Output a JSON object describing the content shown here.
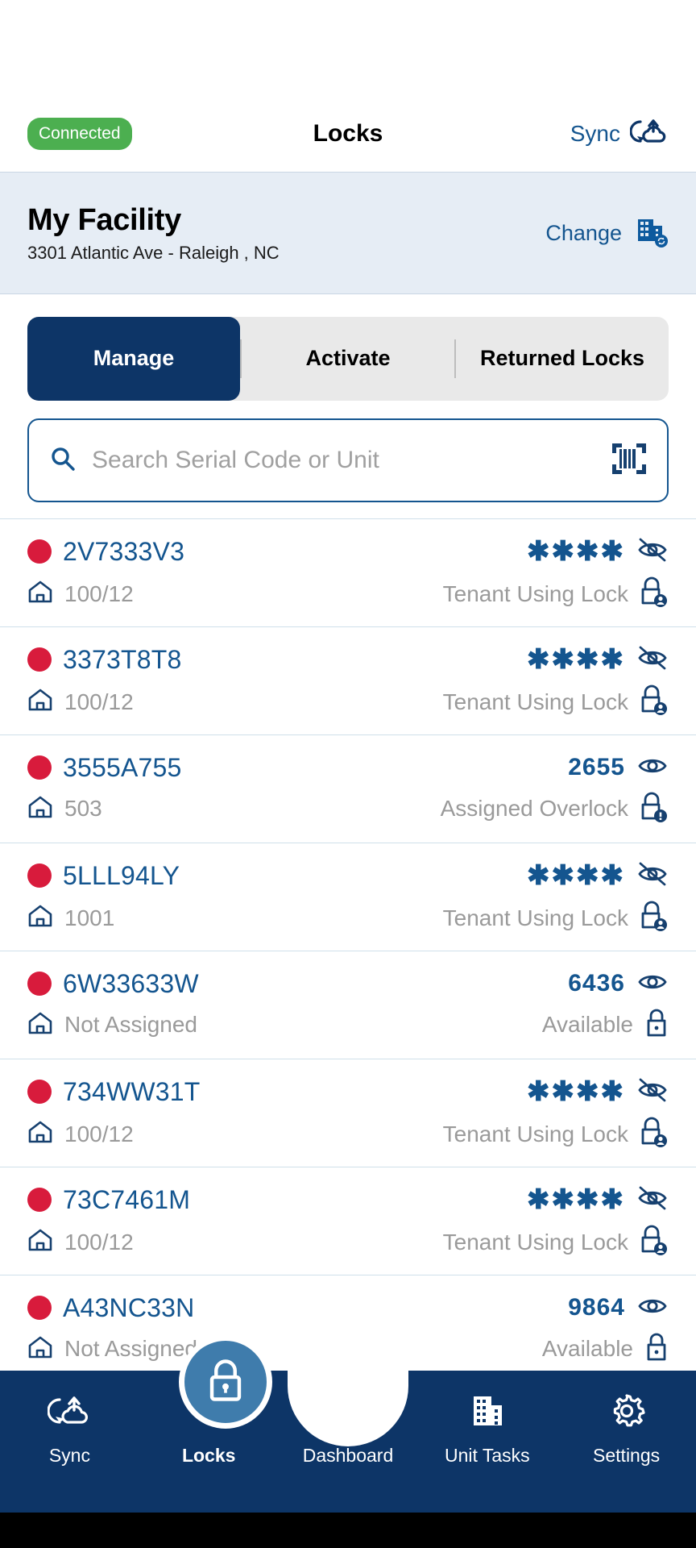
{
  "status_bar": {
    "connection_badge": "Connected"
  },
  "topbar": {
    "title": "Locks",
    "sync_label": "Sync",
    "sync_icon": "cloud-sync-icon"
  },
  "facility": {
    "name": "My Facility",
    "address": "3301 Atlantic Ave - Raleigh , NC",
    "change_label": "Change",
    "change_icon": "building-swap-icon"
  },
  "tabs": [
    {
      "label": "Manage",
      "active": true
    },
    {
      "label": "Activate",
      "active": false
    },
    {
      "label": "Returned Locks",
      "active": false
    }
  ],
  "tab_labels": {
    "manage": "Manage",
    "activate": "Activate",
    "returned_locks": "Returned Locks"
  },
  "search": {
    "placeholder": "Search Serial Code or Unit",
    "value": "",
    "search_icon": "search-icon",
    "scan_icon": "barcode-scan-icon"
  },
  "locks": [
    {
      "serial": "2V7333V3",
      "unit": "100/12",
      "code": "✱✱✱✱",
      "code_masked": true,
      "status": "Tenant Using Lock",
      "eye_icon": "eye-off-icon",
      "lock_icon": "lock-tenant-icon",
      "dot_color": "#d81b3c"
    },
    {
      "serial": "3373T8T8",
      "unit": "100/12",
      "code": "✱✱✱✱",
      "code_masked": true,
      "status": "Tenant Using Lock",
      "eye_icon": "eye-off-icon",
      "lock_icon": "lock-tenant-icon",
      "dot_color": "#d81b3c"
    },
    {
      "serial": "3555A755",
      "unit": "503",
      "code": "2655",
      "code_masked": false,
      "status": "Assigned Overlock",
      "eye_icon": "eye-icon",
      "lock_icon": "lock-alert-icon",
      "dot_color": "#d81b3c"
    },
    {
      "serial": "5LLL94LY",
      "unit": "1001",
      "code": "✱✱✱✱",
      "code_masked": true,
      "status": "Tenant Using Lock",
      "eye_icon": "eye-off-icon",
      "lock_icon": "lock-tenant-icon",
      "dot_color": "#d81b3c"
    },
    {
      "serial": "6W33633W",
      "unit": "Not Assigned",
      "code": "6436",
      "code_masked": false,
      "status": "Available",
      "eye_icon": "eye-icon",
      "lock_icon": "lock-icon",
      "dot_color": "#d81b3c"
    },
    {
      "serial": "734WW31T",
      "unit": "100/12",
      "code": "✱✱✱✱",
      "code_masked": true,
      "status": "Tenant Using Lock",
      "eye_icon": "eye-off-icon",
      "lock_icon": "lock-tenant-icon",
      "dot_color": "#d81b3c"
    },
    {
      "serial": "73C7461M",
      "unit": "100/12",
      "code": "✱✱✱✱",
      "code_masked": true,
      "status": "Tenant Using Lock",
      "eye_icon": "eye-off-icon",
      "lock_icon": "lock-tenant-icon",
      "dot_color": "#d81b3c"
    },
    {
      "serial": "A43NC33N",
      "unit": "Not Assigned",
      "code": "9864",
      "code_masked": false,
      "status": "Available",
      "eye_icon": "eye-icon",
      "lock_icon": "lock-icon",
      "dot_color": "#d81b3c"
    }
  ],
  "bottom_nav": [
    {
      "label": "Sync",
      "icon": "cloud-sync-icon",
      "active": false
    },
    {
      "label": "Locks",
      "icon": "lock-icon",
      "active": true
    },
    {
      "label": "Dashboard",
      "icon": "gauge-icon",
      "active": false
    },
    {
      "label": "Unit Tasks",
      "icon": "building-icon",
      "active": false
    },
    {
      "label": "Settings",
      "icon": "gear-icon",
      "active": false
    }
  ],
  "nav_labels": {
    "sync": "Sync",
    "locks": "Locks",
    "dashboard": "Dashboard",
    "unit_tasks": "Unit Tasks",
    "settings": "Settings"
  },
  "colors": {
    "brand_navy": "#0d3567",
    "link_blue": "#14558f",
    "accent_red": "#d81b3c",
    "connected_green": "#4caf50",
    "facility_band": "#e6edf5",
    "fab_blue": "#3f7cac"
  }
}
